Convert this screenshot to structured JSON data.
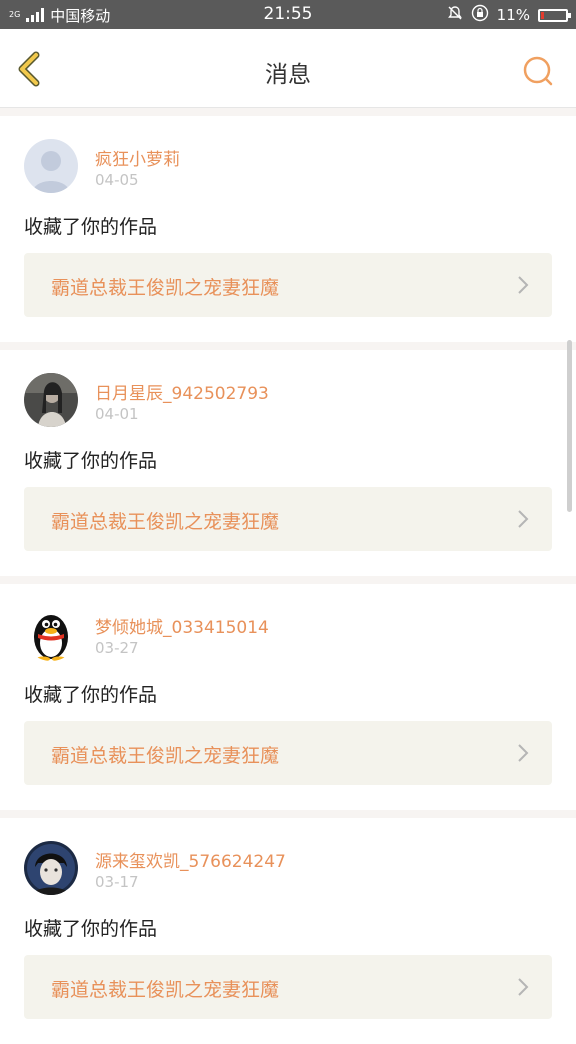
{
  "status_bar": {
    "network": "2G",
    "carrier": "中国移动",
    "time": "21:55",
    "battery": "11%",
    "battery_level": 0.11,
    "battery_color": "#e23b2e"
  },
  "header": {
    "title": "消息",
    "back_icon": "chevron-left-icon",
    "search_icon": "search-icon",
    "accent_color": "#f0a060"
  },
  "messages": [
    {
      "username": "疯狂小萝莉",
      "date": "04-05",
      "action": "收藏了你的作品",
      "work_title": "霸道总裁王俊凯之宠妻狂魔",
      "avatar": "default-avatar"
    },
    {
      "username": "日月星辰_942502793",
      "date": "04-01",
      "action": "收藏了你的作品",
      "work_title": "霸道总裁王俊凯之宠妻狂魔",
      "avatar": "photo-avatar"
    },
    {
      "username": "梦倾她城_033415014",
      "date": "03-27",
      "action": "收藏了你的作品",
      "work_title": "霸道总裁王俊凯之宠妻狂魔",
      "avatar": "penguin-avatar"
    },
    {
      "username": "源来玺欢凯_576624247",
      "date": "03-17",
      "action": "收藏了你的作品",
      "work_title": "霸道总裁王俊凯之宠妻狂魔",
      "avatar": "photo-avatar"
    }
  ]
}
